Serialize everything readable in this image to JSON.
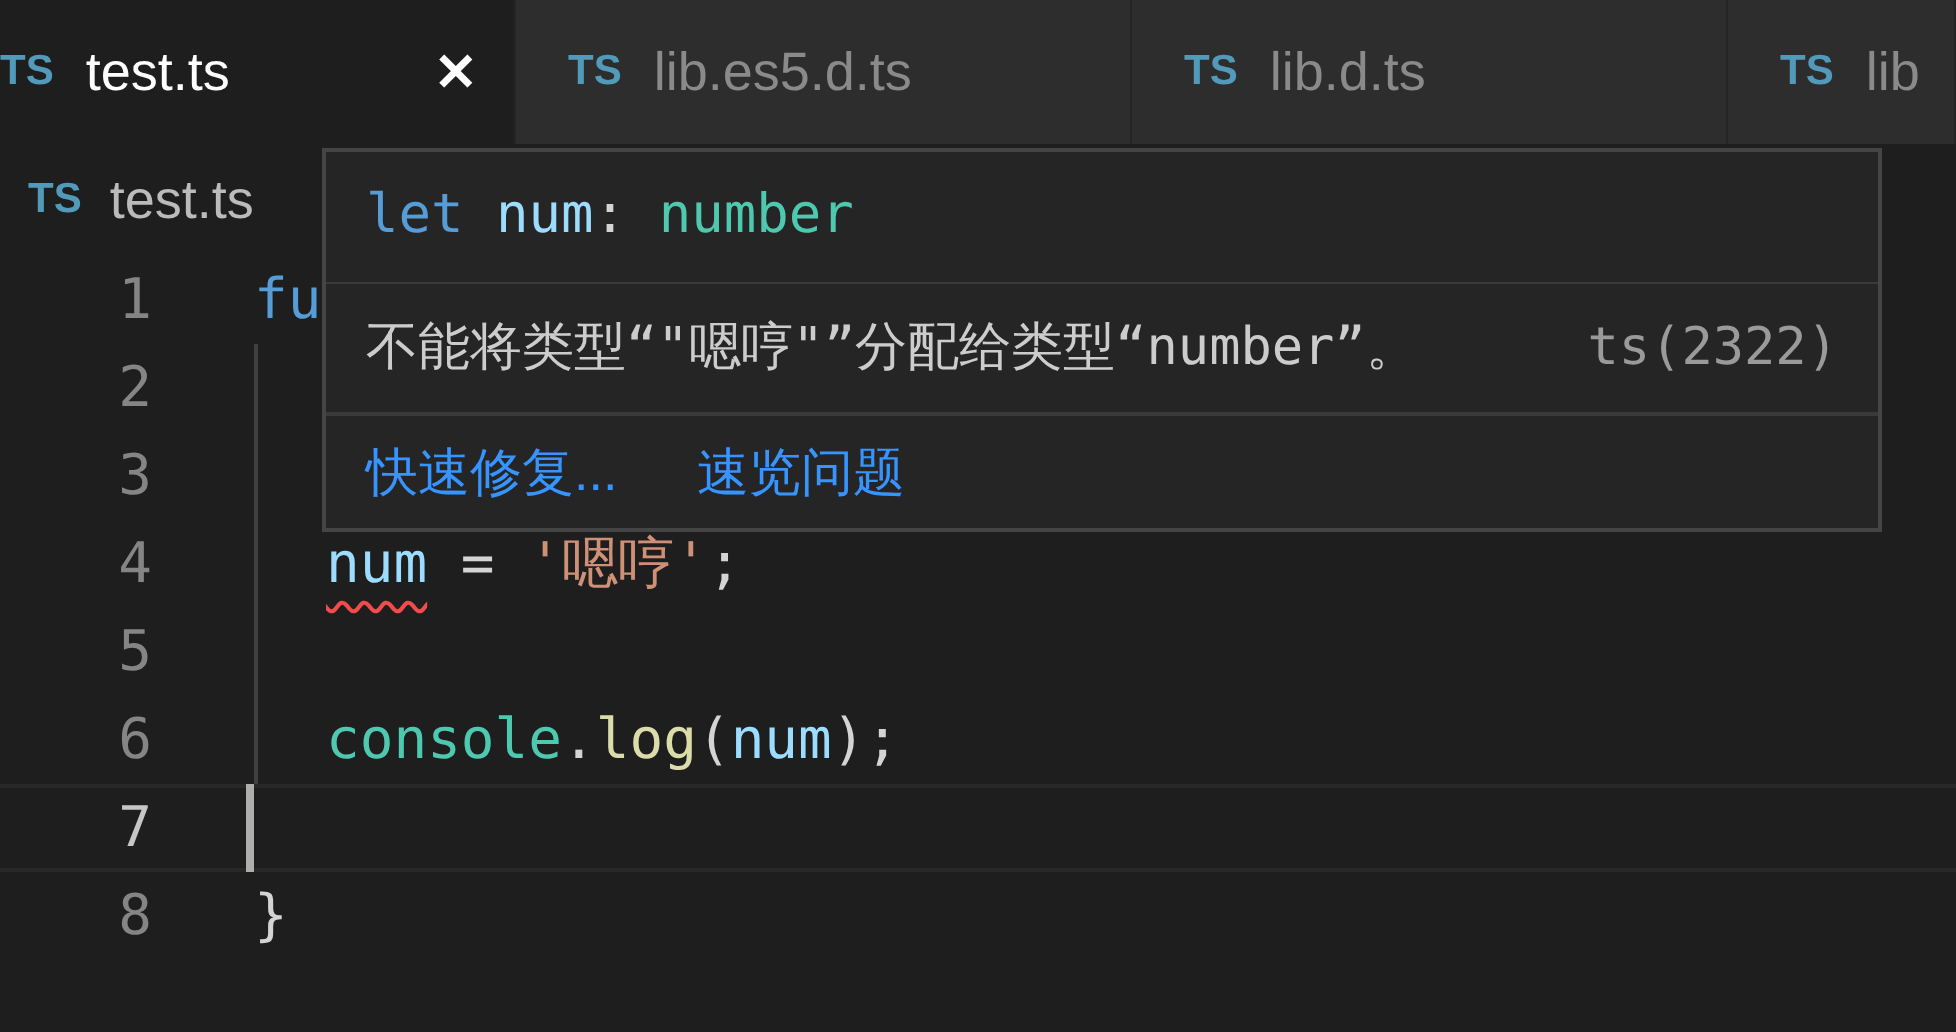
{
  "tabs": [
    {
      "icon": "TS",
      "label": "test.ts",
      "selected": true,
      "close": "✕"
    },
    {
      "icon": "TS",
      "label": "lib.es5.d.ts",
      "selected": false
    },
    {
      "icon": "TS",
      "label": "lib.d.ts",
      "selected": false
    },
    {
      "icon": "TS",
      "label": "lib",
      "selected": false
    }
  ],
  "breadcrumb": {
    "icon": "TS",
    "label": "test.ts"
  },
  "lines": [
    {
      "number": "1",
      "indent_guide": false,
      "current": false,
      "tokens": [
        {
          "text": "fu",
          "kind": "keyword"
        }
      ]
    },
    {
      "number": "2",
      "indent_guide": true,
      "current": false
    },
    {
      "number": "3",
      "indent_guide": true,
      "current": false
    },
    {
      "number": "4",
      "indent_guide": true,
      "current": false,
      "tokens": [
        {
          "text": "num",
          "kind": "variable",
          "error": true
        },
        {
          "text": " = ",
          "kind": "plain"
        },
        {
          "text": "'嗯哼'",
          "kind": "string"
        },
        {
          "text": ";",
          "kind": "plain"
        }
      ]
    },
    {
      "number": "5",
      "indent_guide": true,
      "current": false
    },
    {
      "number": "6",
      "indent_guide": true,
      "current": false,
      "tokens": [
        {
          "text": "console",
          "kind": "class"
        },
        {
          "text": ".",
          "kind": "plain"
        },
        {
          "text": "log",
          "kind": "function"
        },
        {
          "text": "(",
          "kind": "plain"
        },
        {
          "text": "num",
          "kind": "variable"
        },
        {
          "text": ");",
          "kind": "plain"
        }
      ]
    },
    {
      "number": "7",
      "indent_guide": true,
      "current": true
    },
    {
      "number": "8",
      "indent_guide": false,
      "current": false,
      "tokens": [
        {
          "text": "}",
          "kind": "plain"
        }
      ]
    }
  ],
  "hover": {
    "signature": [
      {
        "text": "let",
        "kind": "keyword"
      },
      {
        "text": " num",
        "kind": "variable"
      },
      {
        "text": ": ",
        "kind": "plain"
      },
      {
        "text": "number",
        "kind": "class"
      }
    ],
    "message": "不能将类型“\"嗯哼\"”分配给类型“number”。",
    "code": "ts(2322)",
    "actions": [
      "快速修复...",
      "速览问题"
    ]
  }
}
